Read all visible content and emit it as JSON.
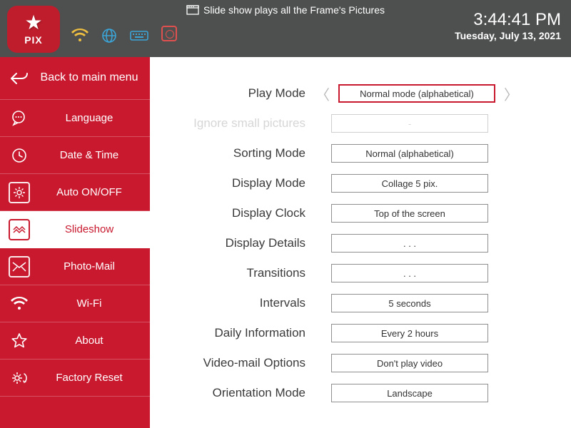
{
  "header": {
    "title": "Slide show plays  all the Frame's Pictures",
    "time": "3:44:41 PM",
    "date": "Tuesday, July 13, 2021",
    "logo_text": "PIX"
  },
  "sidebar": {
    "back": "Back to main menu",
    "items": [
      {
        "label": "Language"
      },
      {
        "label": "Date & Time"
      },
      {
        "label": "Auto ON/OFF"
      },
      {
        "label": "Slideshow"
      },
      {
        "label": "Photo-Mail"
      },
      {
        "label": "Wi-Fi"
      },
      {
        "label": "About"
      },
      {
        "label": "Factory Reset"
      }
    ]
  },
  "settings": [
    {
      "label": "Play Mode",
      "value": "Normal mode (alphabetical)",
      "highlight": true,
      "chevrons": true,
      "disabled": false
    },
    {
      "label": "Ignore small pictures",
      "value": "-",
      "highlight": false,
      "chevrons": false,
      "disabled": true
    },
    {
      "label": "Sorting Mode",
      "value": "Normal (alphabetical)",
      "highlight": false,
      "chevrons": false,
      "disabled": false
    },
    {
      "label": "Display Mode",
      "value": "Collage 5 pix.",
      "highlight": false,
      "chevrons": false,
      "disabled": false
    },
    {
      "label": "Display Clock",
      "value": "Top of the screen",
      "highlight": false,
      "chevrons": false,
      "disabled": false
    },
    {
      "label": "Display Details",
      "value": ". . .",
      "highlight": false,
      "chevrons": false,
      "disabled": false
    },
    {
      "label": "Transitions",
      "value": ". . .",
      "highlight": false,
      "chevrons": false,
      "disabled": false
    },
    {
      "label": "Intervals",
      "value": "5 seconds",
      "highlight": false,
      "chevrons": false,
      "disabled": false
    },
    {
      "label": "Daily Information",
      "value": "Every 2 hours",
      "highlight": false,
      "chevrons": false,
      "disabled": false
    },
    {
      "label": "Video-mail Options",
      "value": "Don't play video",
      "highlight": false,
      "chevrons": false,
      "disabled": false
    },
    {
      "label": "Orientation Mode",
      "value": "Landscape",
      "highlight": false,
      "chevrons": false,
      "disabled": false
    }
  ]
}
